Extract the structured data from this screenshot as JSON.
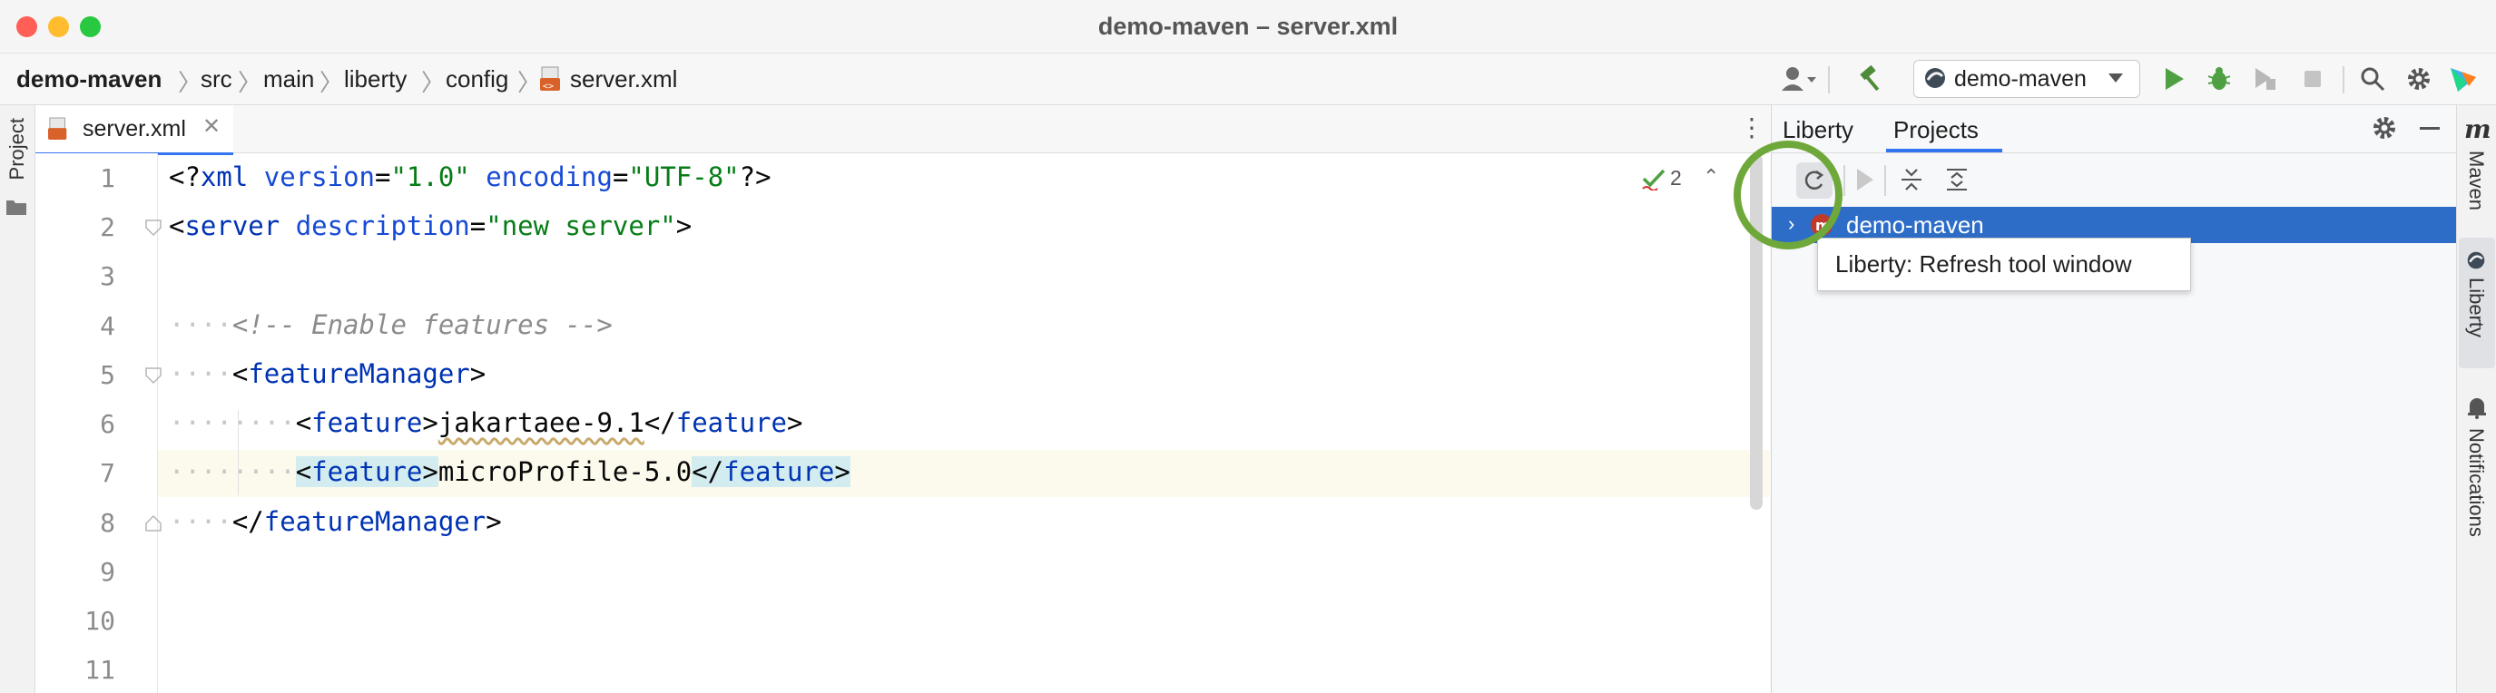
{
  "window": {
    "title": "demo-maven – server.xml"
  },
  "breadcrumb": [
    "demo-maven",
    "src",
    "main",
    "liberty",
    "config",
    "server.xml"
  ],
  "toolbar": {
    "run_config": "demo-maven"
  },
  "left_strip": {
    "project_label": "Project"
  },
  "editor": {
    "tab_label": "server.xml",
    "inspection_count": "2",
    "line_numbers": [
      "1",
      "2",
      "3",
      "4",
      "5",
      "6",
      "7",
      "8",
      "9",
      "10",
      "11"
    ],
    "lines": {
      "l1": {
        "open": "<?",
        "name": "xml",
        "a1": "version",
        "v1": "\"1.0\"",
        "a2": "encoding",
        "v2": "\"UTF-8\"",
        "close": "?>"
      },
      "l2": {
        "open": "<",
        "name": "server",
        "attr": "description",
        "eq": "=",
        "value": "\"new server\"",
        "close": ">"
      },
      "l4": {
        "dots": "····",
        "comment": "<!-- Enable features -->"
      },
      "l5": {
        "dots": "····",
        "open": "<",
        "name": "featureManager",
        "close": ">"
      },
      "l6": {
        "dots": "········",
        "open": "<",
        "name": "feature",
        "close": ">",
        "text": "jakartaee-9.1",
        "end_open": "</",
        "end_name": "feature",
        "end_close": ">"
      },
      "l7": {
        "dots": "········",
        "open": "<",
        "name": "feature",
        "close": ">",
        "text": "microProfile-5.0",
        "end_open": "</",
        "end_name": "feature",
        "end_close": ">"
      },
      "l8": {
        "dots": "····",
        "open": "</",
        "name": "featureManager",
        "close": ">"
      }
    }
  },
  "liberty_panel": {
    "tabs": [
      "Liberty",
      "Projects"
    ],
    "tree_item": "demo-maven",
    "tooltip": "Liberty: Refresh tool window"
  },
  "right_strip": {
    "maven_label": "Maven",
    "liberty_label": "Liberty",
    "notifications_label": "Notifications"
  },
  "colors": {
    "accent": "#3574f0",
    "selection": "#2e6dc7",
    "highlight_ring": "#6fa83a"
  },
  "icons": [
    "user-icon",
    "hammer-icon",
    "run-icon",
    "debug-icon",
    "coverage-icon",
    "stop-icon",
    "search-icon",
    "gear-icon",
    "jetbrains-logo-icon",
    "refresh-icon",
    "expand-all-icon",
    "collapse-all-icon",
    "minimize-icon",
    "folder-icon",
    "xml-file-icon",
    "bell-icon",
    "maven-icon",
    "liberty-icon"
  ]
}
